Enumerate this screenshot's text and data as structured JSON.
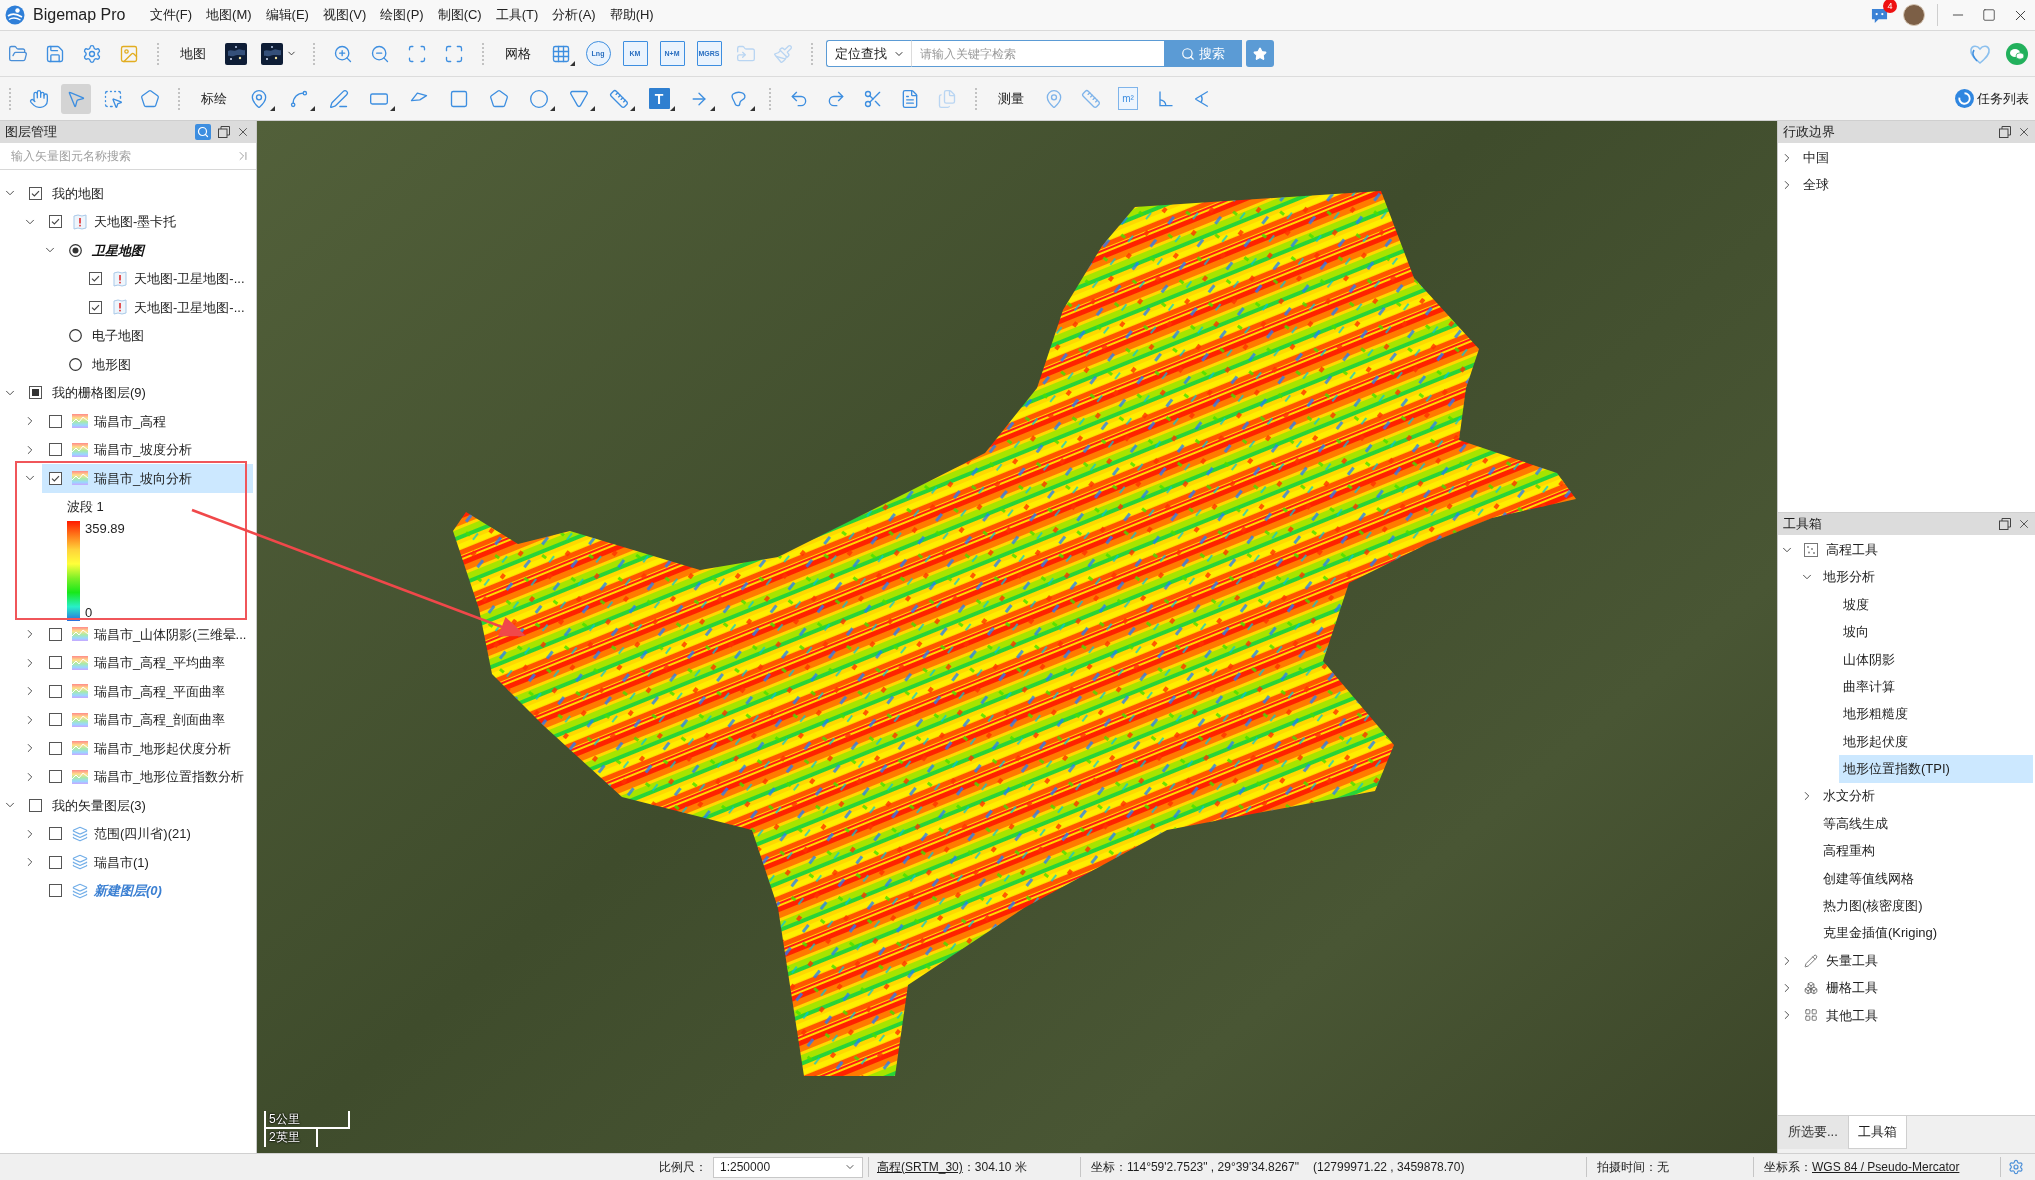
{
  "window": {
    "title": "Bigemap Pro",
    "notification_count": "4"
  },
  "menu": [
    "文件(F)",
    "地图(M)",
    "编辑(E)",
    "视图(V)",
    "绘图(P)",
    "制图(C)",
    "工具(T)",
    "分析(A)",
    "帮助(H)"
  ],
  "toolbar": {
    "map_label": "地图",
    "grid_label": "网格",
    "grid_tools": [
      {
        "disabled": false
      },
      {
        "label": "Lng",
        "disabled": false
      },
      {
        "label": "KM",
        "disabled": false
      },
      {
        "label": "N+M",
        "disabled": false
      },
      {
        "label": "MGRS",
        "disabled": false
      },
      {
        "disabled": true
      },
      {
        "disabled": true
      }
    ],
    "locate_mode": "定位查找",
    "search_placeholder": "请输入关键字检索",
    "search_button": "搜索",
    "pointer_tools": [
      {
        "selected": false
      },
      {
        "selected": true
      },
      {
        "selected": false
      },
      {
        "selected": false
      }
    ],
    "plot_label": "标绘",
    "text_tool_label": "T",
    "edit_tools": [
      {
        "disabled": false
      },
      {
        "disabled": false
      },
      {
        "disabled": false
      },
      {
        "disabled": false
      },
      {
        "disabled": true
      }
    ],
    "measure_label": "测量",
    "area_tool_label": "m²",
    "task_list": "任务列表"
  },
  "layer_panel": {
    "title": "图层管理",
    "search_placeholder": "输入矢量图元名称搜索",
    "tree": [
      {
        "label": "我的地图",
        "kind": "group",
        "checked": true,
        "partial": false,
        "expanded": true,
        "selected": false,
        "current": false,
        "children": [
          {
            "label": "天地图-墨卡托",
            "kind": "basemap",
            "checked": true,
            "expanded": true,
            "selected": false,
            "current": false,
            "children": [
              {
                "label": "卫星地图",
                "kind": "radio",
                "checked": true,
                "expanded": true,
                "selected": false,
                "current": true,
                "children": [
                  {
                    "label": "天地图-卫星地图-...",
                    "kind": "basemap",
                    "checked": true,
                    "selected": false,
                    "current": false
                  },
                  {
                    "label": "天地图-卫星地图-...",
                    "kind": "basemap",
                    "checked": true,
                    "selected": false,
                    "current": false
                  }
                ]
              },
              {
                "label": "电子地图",
                "kind": "radio",
                "checked": false,
                "selected": false,
                "current": false
              },
              {
                "label": "地形图",
                "kind": "radio",
                "checked": false,
                "selected": false,
                "current": false
              }
            ]
          }
        ]
      },
      {
        "label": "我的栅格图层(9)",
        "kind": "group",
        "checked": false,
        "partial": true,
        "expanded": true,
        "selected": false,
        "current": false,
        "children": [
          {
            "label": "瑞昌市_高程",
            "kind": "raster",
            "checked": false,
            "expanded": false,
            "selected": false,
            "current": false
          },
          {
            "label": "瑞昌市_坡度分析",
            "kind": "raster",
            "checked": false,
            "expanded": false,
            "selected": false,
            "current": false
          },
          {
            "label": "瑞昌市_坡向分析",
            "kind": "raster",
            "checked": true,
            "expanded": true,
            "selected": true,
            "current": false,
            "legend": {
              "band": "波段 1",
              "max": "359.89",
              "min": "0"
            }
          },
          {
            "label": "瑞昌市_山体阴影(三维晕...",
            "kind": "raster",
            "checked": false,
            "expanded": false,
            "selected": false,
            "current": false
          },
          {
            "label": "瑞昌市_高程_平均曲率",
            "kind": "raster",
            "checked": false,
            "expanded": false,
            "selected": false,
            "current": false
          },
          {
            "label": "瑞昌市_高程_平面曲率",
            "kind": "raster",
            "checked": false,
            "expanded": false,
            "selected": false,
            "current": false
          },
          {
            "label": "瑞昌市_高程_剖面曲率",
            "kind": "raster",
            "checked": false,
            "expanded": false,
            "selected": false,
            "current": false
          },
          {
            "label": "瑞昌市_地形起伏度分析",
            "kind": "raster",
            "checked": false,
            "expanded": false,
            "selected": false,
            "current": false
          },
          {
            "label": "瑞昌市_地形位置指数分析",
            "kind": "raster",
            "checked": false,
            "expanded": false,
            "selected": false,
            "current": false
          }
        ]
      },
      {
        "label": "我的矢量图层(3)",
        "kind": "group",
        "checked": false,
        "partial": false,
        "expanded": true,
        "selected": false,
        "current": false,
        "children": [
          {
            "label": "范围(四川省)(21)",
            "kind": "vector",
            "checked": false,
            "expanded": false,
            "selected": false,
            "current": false
          },
          {
            "label": "瑞昌市(1)",
            "kind": "vector",
            "checked": false,
            "expanded": false,
            "selected": false,
            "current": false
          },
          {
            "label": "新建图层(0)",
            "kind": "vector",
            "checked": false,
            "selected": false,
            "current": true
          }
        ]
      }
    ]
  },
  "map": {
    "scale_bar": [
      "5公里",
      "2英里"
    ]
  },
  "admin_panel": {
    "title": "行政边界",
    "items": [
      {
        "label": "中国",
        "expanded": false
      },
      {
        "label": "全球",
        "expanded": false
      }
    ]
  },
  "toolbox": {
    "title": "工具箱",
    "tree": [
      {
        "label": "高程工具",
        "expanded": true,
        "selected": false,
        "children": [
          {
            "label": "地形分析",
            "expanded": true,
            "selected": false,
            "children": [
              {
                "label": "坡度",
                "selected": false
              },
              {
                "label": "坡向",
                "selected": false
              },
              {
                "label": "山体阴影",
                "selected": false
              },
              {
                "label": "曲率计算",
                "selected": false
              },
              {
                "label": "地形粗糙度",
                "selected": false
              },
              {
                "label": "地形起伏度",
                "selected": false
              },
              {
                "label": "地形位置指数(TPI)",
                "selected": true
              }
            ]
          },
          {
            "label": "水文分析",
            "expanded": false,
            "selected": false
          },
          {
            "label": "等高线生成",
            "selected": false
          },
          {
            "label": "高程重构",
            "selected": false
          },
          {
            "label": "创建等值线网格",
            "selected": false
          },
          {
            "label": "热力图(核密度图)",
            "selected": false
          },
          {
            "label": "克里金插值(Kriging)",
            "selected": false
          }
        ]
      },
      {
        "label": "矢量工具",
        "expanded": false,
        "selected": false
      },
      {
        "label": "栅格工具",
        "expanded": false,
        "selected": false
      },
      {
        "label": "其他工具",
        "expanded": false,
        "selected": false
      }
    ]
  },
  "panel_tabs": [
    {
      "label": "所选要...",
      "selected": false
    },
    {
      "label": "工具箱",
      "selected": true
    }
  ],
  "status_bar": {
    "scale_label": "比例尺：",
    "scale": "1:250000",
    "elevation_source": "高程(SRTM_30)",
    "elevation": "：304.10 米",
    "coordinates": "坐标：114°59'2.7523\" , 29°39'34.8267\"",
    "projected": "(12799971.22 , 3459878.70)",
    "capture_time": "拍摄时间：无",
    "crs_label": "坐标系：",
    "crs": "WGS 84 / Pseudo-Mercator"
  }
}
